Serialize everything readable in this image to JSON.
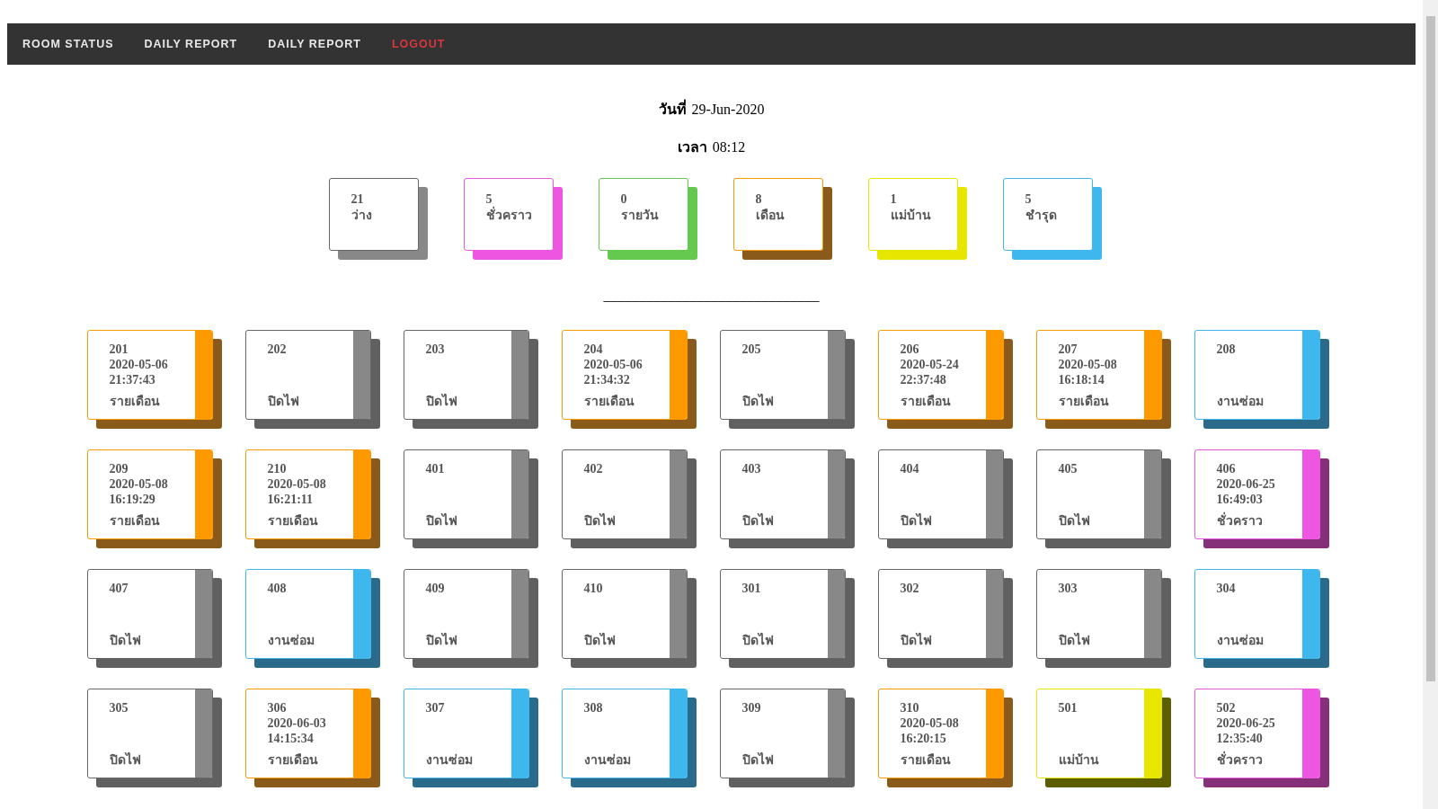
{
  "nav": [
    {
      "label": "ROOM STATUS",
      "kind": "link"
    },
    {
      "label": "DAILY REPORT",
      "kind": "link"
    },
    {
      "label": "DAILY REPORT",
      "kind": "link"
    },
    {
      "label": "LOGOUT",
      "kind": "logout"
    }
  ],
  "date": {
    "label": "วันที่",
    "value": "29-Jun-2020"
  },
  "time": {
    "label": "เวลา",
    "value": "08:12"
  },
  "summary": [
    {
      "count": "21",
      "label": "ว่าง",
      "kind": "vacant"
    },
    {
      "count": "5",
      "label": "ชั่วคราว",
      "kind": "temp"
    },
    {
      "count": "0",
      "label": "รายวัน",
      "kind": "daily"
    },
    {
      "count": "8",
      "label": "เดือน",
      "kind": "monthly"
    },
    {
      "count": "1",
      "label": "แม่บ้าน",
      "kind": "maid"
    },
    {
      "count": "5",
      "label": "ชำรุด",
      "kind": "repair"
    }
  ],
  "divider": "______________________________",
  "rooms": [
    {
      "number": "201",
      "date": "2020-05-06",
      "time": "21:37:43",
      "status": "รายเดือน",
      "kind": "monthly"
    },
    {
      "number": "202",
      "status": "ปิดไฟ",
      "kind": "off"
    },
    {
      "number": "203",
      "status": "ปิดไฟ",
      "kind": "off"
    },
    {
      "number": "204",
      "date": "2020-05-06",
      "time": "21:34:32",
      "status": "รายเดือน",
      "kind": "monthly"
    },
    {
      "number": "205",
      "status": "ปิดไฟ",
      "kind": "off"
    },
    {
      "number": "206",
      "date": "2020-05-24",
      "time": "22:37:48",
      "status": "รายเดือน",
      "kind": "monthly"
    },
    {
      "number": "207",
      "date": "2020-05-08",
      "time": "16:18:14",
      "status": "รายเดือน",
      "kind": "monthly"
    },
    {
      "number": "208",
      "status": "งานซ่อม",
      "kind": "repair"
    },
    {
      "number": "209",
      "date": "2020-05-08",
      "time": "16:19:29",
      "status": "รายเดือน",
      "kind": "monthly"
    },
    {
      "number": "210",
      "date": "2020-05-08",
      "time": "16:21:11",
      "status": "รายเดือน",
      "kind": "monthly"
    },
    {
      "number": "401",
      "status": "ปิดไฟ",
      "kind": "off"
    },
    {
      "number": "402",
      "status": "ปิดไฟ",
      "kind": "off"
    },
    {
      "number": "403",
      "status": "ปิดไฟ",
      "kind": "off"
    },
    {
      "number": "404",
      "status": "ปิดไฟ",
      "kind": "off"
    },
    {
      "number": "405",
      "status": "ปิดไฟ",
      "kind": "off"
    },
    {
      "number": "406",
      "date": "2020-06-25",
      "time": "16:49:03",
      "status": "ชั่วคราว",
      "kind": "temp"
    },
    {
      "number": "407",
      "status": "ปิดไฟ",
      "kind": "off"
    },
    {
      "number": "408",
      "status": "งานซ่อม",
      "kind": "repair"
    },
    {
      "number": "409",
      "status": "ปิดไฟ",
      "kind": "off"
    },
    {
      "number": "410",
      "status": "ปิดไฟ",
      "kind": "off"
    },
    {
      "number": "301",
      "status": "ปิดไฟ",
      "kind": "off"
    },
    {
      "number": "302",
      "status": "ปิดไฟ",
      "kind": "off"
    },
    {
      "number": "303",
      "status": "ปิดไฟ",
      "kind": "off"
    },
    {
      "number": "304",
      "status": "งานซ่อม",
      "kind": "repair"
    },
    {
      "number": "305",
      "status": "ปิดไฟ",
      "kind": "off"
    },
    {
      "number": "306",
      "date": "2020-06-03",
      "time": "14:15:34",
      "status": "รายเดือน",
      "kind": "monthly"
    },
    {
      "number": "307",
      "status": "งานซ่อม",
      "kind": "repair"
    },
    {
      "number": "308",
      "status": "งานซ่อม",
      "kind": "repair"
    },
    {
      "number": "309",
      "status": "ปิดไฟ",
      "kind": "off"
    },
    {
      "number": "310",
      "date": "2020-05-08",
      "time": "16:20:15",
      "status": "รายเดือน",
      "kind": "monthly"
    },
    {
      "number": "501",
      "status": "แม่บ้าน",
      "kind": "maid"
    },
    {
      "number": "502",
      "date": "2020-06-25",
      "time": "12:35:40",
      "status": "ชั่วคราว",
      "kind": "temp"
    }
  ]
}
